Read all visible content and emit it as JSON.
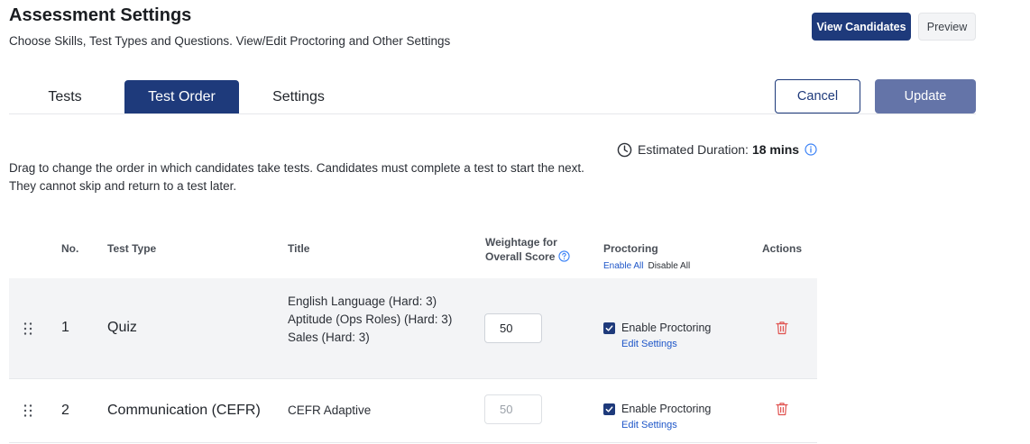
{
  "header": {
    "title": "Assessment Settings",
    "subtitle": "Choose Skills, Test Types and Questions. View/Edit Proctoring and Other Settings",
    "view_candidates_label": "View Candidates",
    "preview_label": "Preview"
  },
  "tabs": [
    {
      "label": "Tests",
      "active": false
    },
    {
      "label": "Test Order",
      "active": true
    },
    {
      "label": "Settings",
      "active": false
    }
  ],
  "actions": {
    "cancel_label": "Cancel",
    "update_label": "Update"
  },
  "duration": {
    "label": "Estimated Duration:",
    "value": "18 mins"
  },
  "instructions": "Drag to change the order in which candidates take tests. Candidates must complete a test to start the next. They cannot skip and return to a test later.",
  "table": {
    "columns": {
      "no": "No.",
      "test_type": "Test Type",
      "title": "Title",
      "weightage": "Weightage for Overall Score",
      "proctoring": "Proctoring",
      "actions": "Actions"
    },
    "enable_all": "Enable All",
    "disable_all": "Disable All",
    "rows": [
      {
        "no": "1",
        "test_type": "Quiz",
        "title_lines": [
          "English Language (Hard: 3)",
          "Aptitude (Ops Roles) (Hard: 3)",
          "Sales (Hard: 3)"
        ],
        "weightage": "50",
        "weightage_editable": true,
        "proctoring_label": "Enable Proctoring",
        "proctoring_checked": true,
        "edit_settings": "Edit Settings"
      },
      {
        "no": "2",
        "test_type": "Communication (CEFR)",
        "title_lines": [
          "CEFR Adaptive"
        ],
        "weightage": "50",
        "weightage_editable": false,
        "proctoring_label": "Enable Proctoring",
        "proctoring_checked": true,
        "edit_settings": "Edit Settings"
      }
    ]
  },
  "colors": {
    "primary": "#1e3a7b",
    "update_button": "#6474a8",
    "link": "#1e56c8",
    "delete": "#e0524f",
    "row_highlight": "#f3f4f6"
  },
  "icons": {
    "duration": "clock-icon",
    "duration_info": "info-icon",
    "weight_help": "help-icon",
    "drag": "drag-handle-icon",
    "delete": "trash-icon",
    "checkbox": "checkmark-icon"
  }
}
